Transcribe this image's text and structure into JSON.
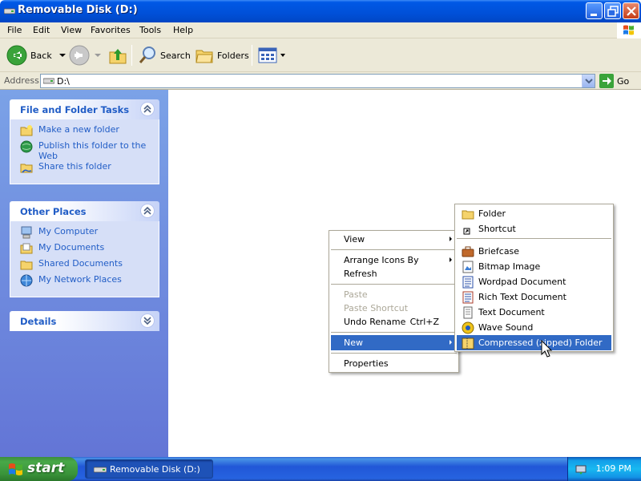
{
  "window": {
    "title": "Removable Disk (D:)"
  },
  "menubar": {
    "items": [
      "File",
      "Edit",
      "View",
      "Favorites",
      "Tools",
      "Help"
    ]
  },
  "toolbar": {
    "back": "Back",
    "search": "Search",
    "folders": "Folders"
  },
  "address": {
    "label": "Address",
    "value": "D:\\",
    "go": "Go"
  },
  "tasks_panel": {
    "title": "File and Folder Tasks",
    "items": [
      {
        "label": "Make a new folder",
        "icon": "new-folder-icon"
      },
      {
        "label": "Publish this folder to the Web",
        "icon": "publish-web-icon"
      },
      {
        "label": "Share this folder",
        "icon": "share-folder-icon"
      }
    ]
  },
  "places_panel": {
    "title": "Other Places",
    "items": [
      {
        "label": "My Computer",
        "icon": "my-computer-icon"
      },
      {
        "label": "My Documents",
        "icon": "my-documents-icon"
      },
      {
        "label": "Shared Documents",
        "icon": "shared-documents-icon"
      },
      {
        "label": "My Network Places",
        "icon": "network-places-icon"
      }
    ]
  },
  "details_panel": {
    "title": "Details"
  },
  "context_menu": {
    "view": "View",
    "arrange": "Arrange Icons By",
    "refresh": "Refresh",
    "paste": "Paste",
    "paste_shortcut": "Paste Shortcut",
    "undo_rename": "Undo Rename",
    "undo_shortcut": "Ctrl+Z",
    "new": "New",
    "properties": "Properties"
  },
  "new_submenu": {
    "items": [
      {
        "label": "Folder",
        "icon": "folder-icon"
      },
      {
        "label": "Shortcut",
        "icon": "shortcut-icon"
      },
      {
        "label": "Briefcase",
        "icon": "briefcase-icon"
      },
      {
        "label": "Bitmap Image",
        "icon": "bitmap-icon"
      },
      {
        "label": "Wordpad Document",
        "icon": "wordpad-icon"
      },
      {
        "label": "Rich Text Document",
        "icon": "rich-text-icon"
      },
      {
        "label": "Text Document",
        "icon": "text-document-icon"
      },
      {
        "label": "Wave Sound",
        "icon": "wave-sound-icon"
      },
      {
        "label": "Compressed (zipped) Folder",
        "icon": "zip-folder-icon"
      }
    ]
  },
  "taskbar": {
    "start": "start",
    "task_button": "Removable Disk (D:)",
    "clock": "1:09 PM"
  },
  "colors": {
    "titlebar": "#0054e3",
    "menu_highlight": "#316ac5",
    "link": "#215dc6",
    "taskbar": "#245edb",
    "start": "#3c9a3c"
  }
}
